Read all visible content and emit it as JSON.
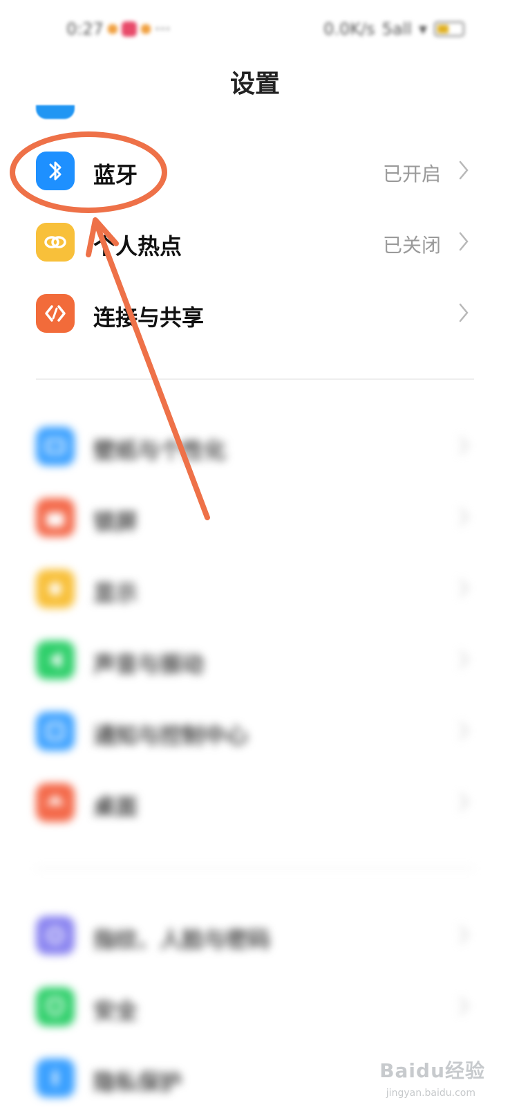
{
  "status_bar": {
    "time": "0:27",
    "ellipsis": "···",
    "net_speed": "0.0K/s",
    "signal": "5all"
  },
  "header": {
    "title": "设置"
  },
  "section1": [
    {
      "label": "蓝牙",
      "status": "已开启",
      "icon": "bluetooth-icon",
      "color": "#1e90ff"
    },
    {
      "label": "个人热点",
      "status": "已关闭",
      "icon": "hotspot-icon",
      "color": "#f8c03a"
    },
    {
      "label": "连接与共享",
      "status": "",
      "icon": "share-icon",
      "color": "#f26b3a"
    }
  ],
  "section2": [
    {
      "label": "壁纸与个性化",
      "icon": "wallpaper-icon",
      "color": "#3aa0ff"
    },
    {
      "label": "锁屏",
      "icon": "lock-icon",
      "color": "#f4694a"
    },
    {
      "label": "显示",
      "icon": "display-icon",
      "color": "#f8c03a"
    },
    {
      "label": "声音与振动",
      "icon": "sound-icon",
      "color": "#2ecf6a"
    },
    {
      "label": "通知与控制中心",
      "icon": "notification-icon",
      "color": "#3aa0ff"
    },
    {
      "label": "桌面",
      "icon": "home-icon",
      "color": "#f4694a"
    }
  ],
  "section3": [
    {
      "label": "指纹、人脸与密码",
      "icon": "fingerprint-icon",
      "color": "#8a84f0"
    },
    {
      "label": "安全",
      "icon": "security-icon",
      "color": "#2ecf6a"
    },
    {
      "label": "隐私保护",
      "icon": "privacy-icon",
      "color": "#3aa0ff"
    }
  ],
  "annotation": {
    "color": "#ee7148"
  },
  "watermark": {
    "text": "Baidu经验",
    "sub": "jingyan.baidu.com"
  }
}
